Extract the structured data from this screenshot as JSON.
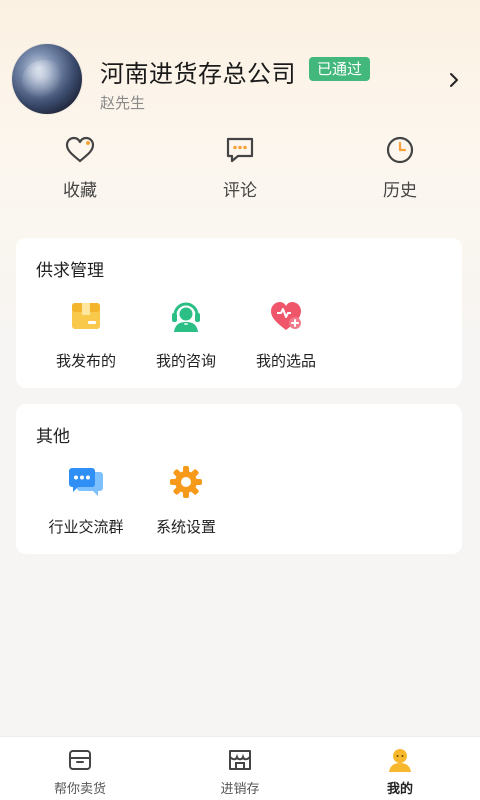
{
  "profile": {
    "company": "河南进货存总公司",
    "badge": "已通过",
    "username": "赵先生"
  },
  "quick": [
    {
      "label": "收藏",
      "icon": "heart-icon"
    },
    {
      "label": "评论",
      "icon": "comment-icon"
    },
    {
      "label": "历史",
      "icon": "clock-icon"
    }
  ],
  "supply": {
    "title": "供求管理",
    "items": [
      {
        "label": "我发布的",
        "icon": "box-icon"
      },
      {
        "label": "我的咨询",
        "icon": "headset-icon"
      },
      {
        "label": "我的选品",
        "icon": "heart-plus-icon"
      }
    ]
  },
  "other": {
    "title": "其他",
    "items": [
      {
        "label": "行业交流群",
        "icon": "chat-bubbles-icon"
      },
      {
        "label": "系统设置",
        "icon": "gear-icon"
      }
    ]
  },
  "tabbar": {
    "items": [
      {
        "label": "帮你卖货",
        "icon": "shop-box-icon"
      },
      {
        "label": "进销存",
        "icon": "store-icon"
      },
      {
        "label": "我的",
        "icon": "user-icon",
        "active": true
      }
    ]
  },
  "colors": {
    "badge": "#43b87c",
    "box": "#f8c94a",
    "headset": "#2bbf86",
    "heart": "#f0566a",
    "chat": "#2f8ff4",
    "gear": "#f79a1c",
    "user": "#f7b82e"
  }
}
